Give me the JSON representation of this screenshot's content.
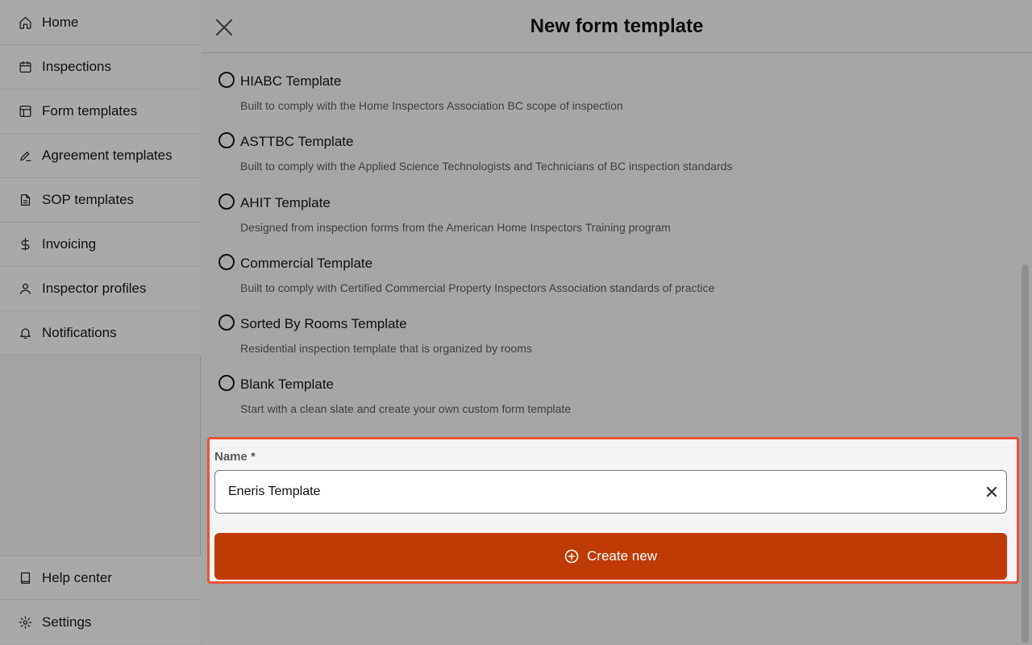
{
  "sidebar": {
    "items": [
      {
        "label": "Home",
        "icon": "home-icon"
      },
      {
        "label": "Inspections",
        "icon": "calendar-icon"
      },
      {
        "label": "Form templates",
        "icon": "layout-icon"
      },
      {
        "label": "Agreement templates",
        "icon": "signature-icon"
      },
      {
        "label": "SOP templates",
        "icon": "document-icon"
      },
      {
        "label": "Invoicing",
        "icon": "dollar-icon"
      },
      {
        "label": "Inspector profiles",
        "icon": "user-icon"
      },
      {
        "label": "Notifications",
        "icon": "bell-icon"
      }
    ],
    "bottom_items": [
      {
        "label": "Help center",
        "icon": "book-icon"
      },
      {
        "label": "Settings",
        "icon": "gear-icon"
      }
    ]
  },
  "header": {
    "title": "New form template",
    "close_icon": "close-icon"
  },
  "options": [
    {
      "title": "HIABC Template",
      "description": "Built to comply with the Home Inspectors Association BC scope of inspection",
      "selected": false
    },
    {
      "title": "ASTTBC Template",
      "description": "Built to comply with the Applied Science Technologists and Technicians of BC inspection standards",
      "selected": false
    },
    {
      "title": "AHIT Template",
      "description": "Designed from inspection forms from the American Home Inspectors Training program",
      "selected": false
    },
    {
      "title": "Commercial Template",
      "description": "Built to comply with Certified Commercial Property Inspectors Association standards of practice",
      "selected": false
    },
    {
      "title": "Sorted By Rooms Template",
      "description": "Residential inspection template that is organized by rooms",
      "selected": false
    },
    {
      "title": "Blank Template",
      "description": "Start with a clean slate and create your own custom form template",
      "selected": false
    }
  ],
  "form": {
    "name_label": "Name *",
    "name_value": "Eneris Template",
    "create_label": "Create new"
  },
  "colors": {
    "accent": "#c03a05",
    "highlight_border": "#e8553a"
  }
}
